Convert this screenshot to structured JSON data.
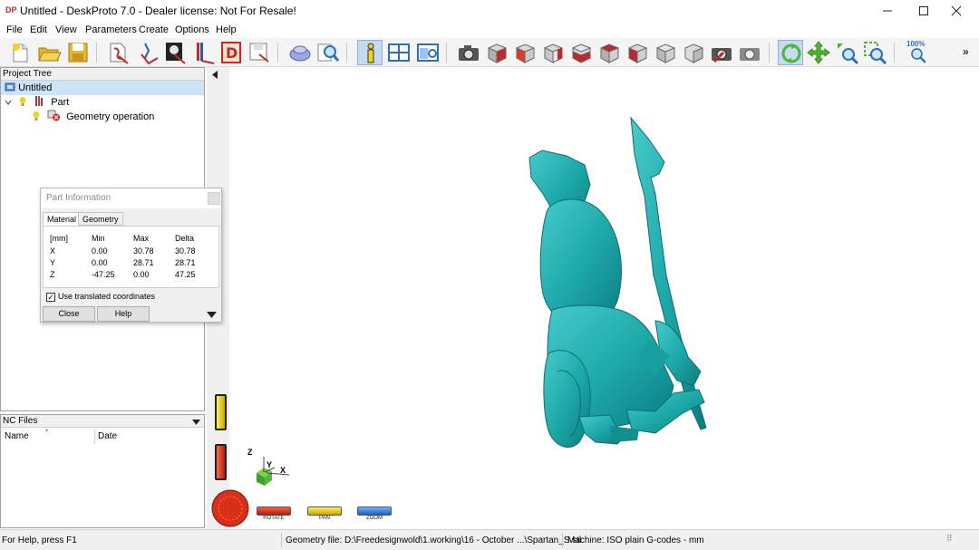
{
  "window": {
    "title": "Untitled - DeskProto 7.0 - Dealer license: Not For Resale!",
    "app_icon_text": "DP"
  },
  "menu": [
    "File",
    "Edit",
    "View",
    "Parameters",
    "Create",
    "Options",
    "Help"
  ],
  "toolbar": {
    "zoom_level": "100%",
    "icons": [
      "new-project-icon",
      "open-project-icon",
      "save-project-icon",
      "import-part-icon",
      "import-vector-icon",
      "import-bitmap-icon",
      "edit-part-icon",
      "create-design-icon",
      "save-design-icon",
      "simulate-icon",
      "find-icon",
      "info-icon",
      "window-layout-icon",
      "view-icon",
      "camera-icon",
      "view-front-icon",
      "view-back-icon",
      "view-left-icon",
      "view-right-icon",
      "view-top-icon",
      "view-bottom-icon",
      "view-iso-icon",
      "view-reset-icon",
      "screenshot-icon",
      "render-settings-icon",
      "rotate-mode-icon",
      "pan-mode-icon",
      "zoom-mode-icon",
      "zoom-window-icon",
      "zoom-fit-icon"
    ],
    "more_glyph": "»"
  },
  "project_tree": {
    "header": "Project Tree",
    "root": "Untitled",
    "items": [
      {
        "label": "Part",
        "level": 1
      },
      {
        "label": "Geometry operation",
        "level": 2
      }
    ]
  },
  "nc_files": {
    "header": "NC Files",
    "columns": [
      "Name",
      "Date"
    ]
  },
  "part_info": {
    "title": "Part Information",
    "tabs": [
      "Material",
      "Geometry"
    ],
    "columns": [
      "[mm]",
      "Min",
      "Max",
      "Delta"
    ],
    "rows": [
      {
        "axis": "X",
        "min": "0.00",
        "max": "30.78",
        "delta": "30.78"
      },
      {
        "axis": "Y",
        "min": "0.00",
        "max": "28.71",
        "delta": "28.71"
      },
      {
        "axis": "Z",
        "min": "-47.25",
        "max": "0.00",
        "delta": "47.25"
      }
    ],
    "checkbox_label": "Use translated coordinates",
    "checkbox_checked": true,
    "close_label": "Close",
    "help_label": "Help"
  },
  "viewport": {
    "axis_labels": {
      "z": "Z",
      "y": "Y",
      "x": "X"
    },
    "mode_buttons": [
      "ROTATE",
      "PAN",
      "ZOOM"
    ],
    "model_color": "#1eaaaa"
  },
  "statusbar": {
    "help": "For Help, press F1",
    "geometry": "Geometry file: D:\\Freedesignwold\\1.working\\16 - October ...\\Spartan_S.stl",
    "machine": "Machine: ISO plain G-codes - mm"
  }
}
